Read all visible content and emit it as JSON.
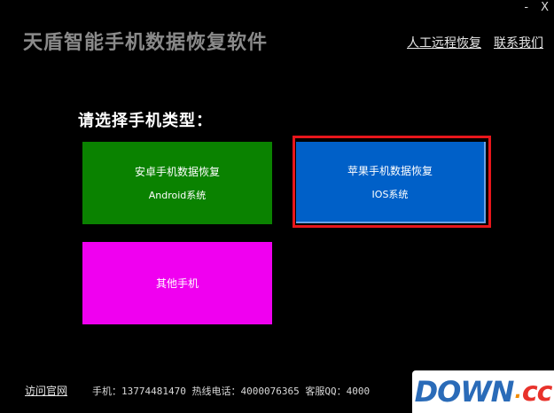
{
  "window": {
    "minimize_label": "-",
    "close_label": "X"
  },
  "header": {
    "title": "天盾智能手机数据恢复软件",
    "link_remote": "人工远程恢复",
    "link_contact": "联系我们"
  },
  "main": {
    "prompt": "请选择手机类型：",
    "tiles": [
      {
        "line1": "安卓手机数据恢复",
        "line2": "Android系统",
        "color": "#0a8200"
      },
      {
        "line1": "苹果手机数据恢复",
        "line2": "IOS系统",
        "color": "#0060c8",
        "selected": true
      },
      {
        "line1": "其他手机",
        "color": "#f000f0"
      }
    ],
    "selection_color": "#e8161b"
  },
  "footer": {
    "link_site": "访问官网",
    "info": "手机：13774481470 热线电话：4000076365 客服QQ：4000"
  },
  "watermark": {
    "part1": "DOWN",
    "part2": ".",
    "part3": "cc"
  }
}
